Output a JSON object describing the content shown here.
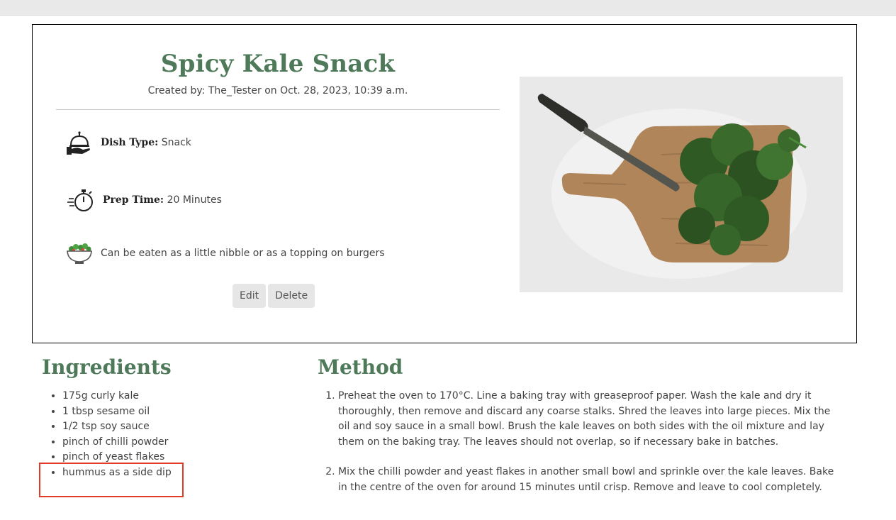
{
  "recipe": {
    "title": "Spicy Kale Snack",
    "created_by": "Created by: The_Tester on Oct. 28, 2023, 10:39 a.m.",
    "dish_type_label": "Dish Type:",
    "dish_type_value": "Snack",
    "prep_time_label": "Prep Time:",
    "prep_time_value": "20 Minutes",
    "description": "Can be eaten as a little nibble or as a topping on burgers",
    "edit_label": "Edit",
    "delete_label": "Delete",
    "image_alt": "Kale on a wooden chopping board with a knife"
  },
  "ingredients": {
    "heading": "Ingredients",
    "items": [
      "175g curly kale",
      "1 tbsp sesame oil",
      "1/2 tsp soy sauce",
      "pinch of chilli powder",
      "pinch of yeast flakes",
      "hummus as a side dip"
    ]
  },
  "method": {
    "heading": "Method",
    "steps": [
      "Preheat the oven to 170°C. Line a baking tray with greaseproof paper. Wash the kale and dry it thoroughly, then remove and discard any coarse stalks. Shred the leaves into large pieces. Mix the oil and soy sauce in a small bowl. Brush the kale leaves on both sides with the oil mixture and lay them on the baking tray. The leaves should not overlap, so if necessary bake in batches.",
      "Mix the chilli powder and yeast flakes in another small bowl and sprinkle over the kale leaves. Bake in the centre of the oven for around 15 minutes until crisp. Remove and leave to cool completely."
    ]
  },
  "icons": {
    "dish_type": "serving-cloche-icon",
    "prep_time": "stopwatch-icon",
    "description": "salad-bowl-icon"
  },
  "colors": {
    "accent": "#4e7a59",
    "highlight": "#e03c28",
    "button_bg": "#e6e6e6"
  }
}
